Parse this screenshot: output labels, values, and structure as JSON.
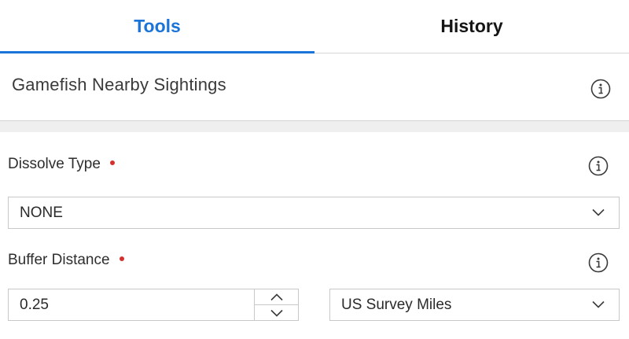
{
  "tabs": [
    {
      "label": "Tools",
      "active": true
    },
    {
      "label": "History",
      "active": false
    }
  ],
  "tool": {
    "title": "Gamefish Nearby Sightings"
  },
  "fields": {
    "dissolve_type": {
      "label": "Dissolve Type",
      "required": true,
      "value": "NONE"
    },
    "buffer_distance": {
      "label": "Buffer Distance",
      "required": true,
      "value": "0.25",
      "unit": "US Survey Miles"
    }
  },
  "colors": {
    "accent": "#1b74d8",
    "required_dot": "#d43030",
    "border": "#c8c8c8",
    "band": "#efefef"
  },
  "icons": {
    "info": "info-circle-icon",
    "chevron": "chevron-down-icon",
    "step_up": "chevron-up-icon",
    "step_down": "chevron-down-icon"
  }
}
